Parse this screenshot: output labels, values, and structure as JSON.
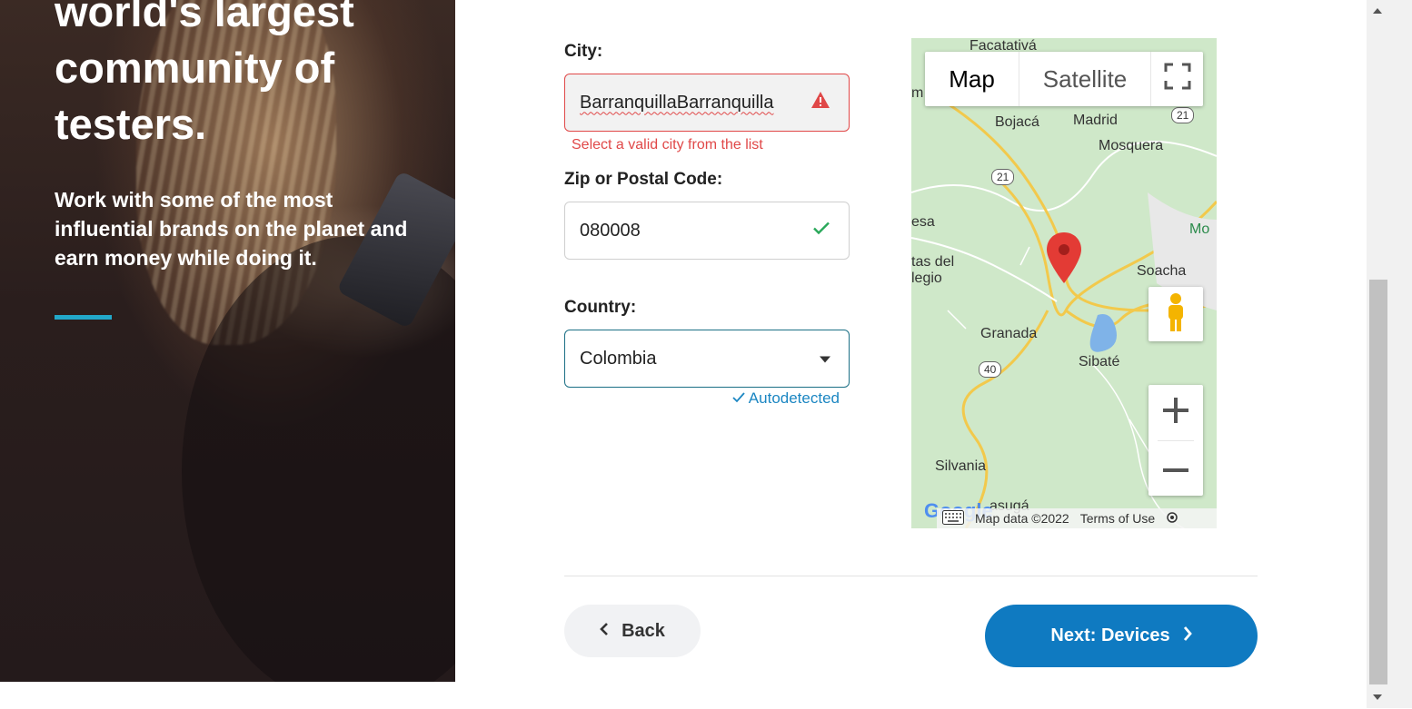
{
  "hero": {
    "title": "world's largest community of testers.",
    "subtitle": "Work with some of the most influential brands on the planet and earn money while doing it."
  },
  "form": {
    "city_label": "City:",
    "city_value": "BarranquillaBarranquilla",
    "city_error": "Select a valid city from the list",
    "zip_label": "Zip or Postal Code:",
    "zip_value": "080008",
    "country_label": "Country:",
    "country_value": "Colombia",
    "autodetected": "Autodetected"
  },
  "map": {
    "tab_map": "Map",
    "tab_satellite": "Satellite",
    "places": [
      {
        "name": "Facatativá"
      },
      {
        "name": "Bojacá"
      },
      {
        "name": "Madrid"
      },
      {
        "name": "Mosquera"
      },
      {
        "name": "esa"
      },
      {
        "name": "tas del"
      },
      {
        "name": "legio"
      },
      {
        "name": "Soacha"
      },
      {
        "name": "Mo"
      },
      {
        "name": "Granada"
      },
      {
        "name": "Sibaté"
      },
      {
        "name": "Silvania"
      },
      {
        "name": "asugá"
      }
    ],
    "routes": [
      "21",
      "21",
      "40"
    ],
    "footer_data": "Map data ©2022",
    "footer_terms": "Terms of Use",
    "google": "Google",
    "m_letter": "m"
  },
  "buttons": {
    "back": "Back",
    "next": "Next: Devices"
  },
  "colors": {
    "accent": "#0f7ac1",
    "error": "#e04848",
    "success": "#2aa85a",
    "link": "#1b86c2"
  }
}
